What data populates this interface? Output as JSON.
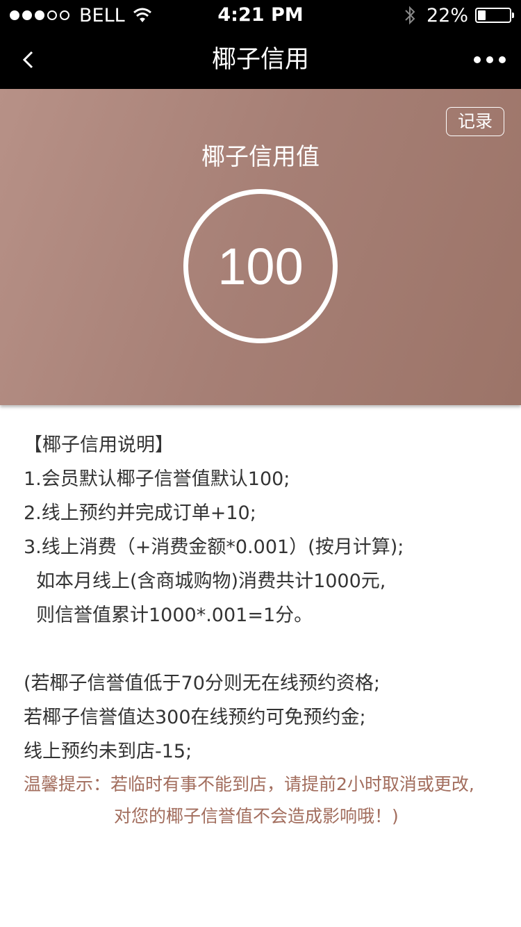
{
  "status_bar": {
    "carrier": "BELL",
    "time": "4:21 PM",
    "battery_text": "22%",
    "battery_level": 0.22
  },
  "nav": {
    "back_label": "<",
    "title": "椰子信用"
  },
  "hero": {
    "record_button": "记录",
    "title": "椰子信用值",
    "score": "100",
    "accent_color": "#a67f75"
  },
  "rules": {
    "heading": "【椰子信用说明】",
    "items": [
      "1.会员默认椰子信誉值默认100;",
      "2.线上预约并完成订单+10;",
      "3.线上消费（+消费金额*0.001）(按月计算);",
      "如本月线上(含商城购物)消费共计1000元,",
      "则信誉值累计1000*.001=1分。"
    ],
    "notes": [
      "(若椰子信誉值低于70分则无在线预约资格;",
      "若椰子信誉值达300在线预约可免预约金;",
      "线上预约未到店-15;"
    ],
    "tip_lines": [
      "温馨提示：若临时有事不能到店，请提前2小时取消或更改,",
      "对您的椰子信誉值不会造成影响哦！)"
    ],
    "tip_color": "#a26d5d"
  }
}
